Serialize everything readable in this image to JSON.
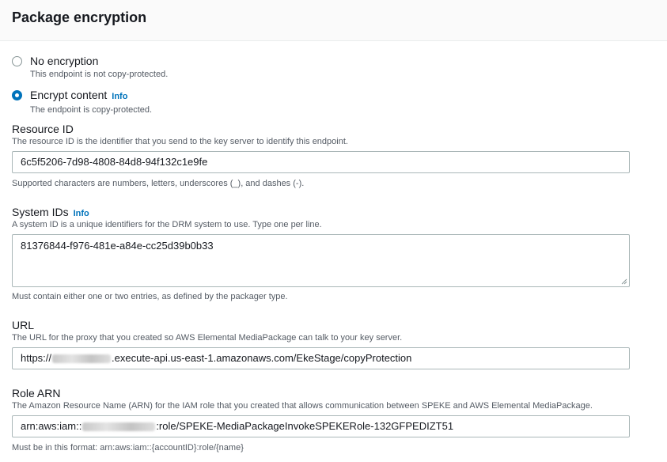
{
  "header": {
    "title": "Package encryption"
  },
  "encryption_options": [
    {
      "label": "No encryption",
      "description": "This endpoint is not copy-protected.",
      "selected": false
    },
    {
      "label": "Encrypt content",
      "info": "Info",
      "description": "The endpoint is copy-protected.",
      "selected": true
    }
  ],
  "resource_id": {
    "label": "Resource ID",
    "description": "The resource ID is the identifier that you send to the key server to identify this endpoint.",
    "value": "6c5f5206-7d98-4808-84d8-94f132c1e9fe",
    "constraint": "Supported characters are numbers, letters, underscores (_), and dashes (-)."
  },
  "system_ids": {
    "label": "System IDs",
    "info": "Info",
    "description": "A system ID is a unique identifiers for the DRM system to use. Type one per line.",
    "value": "81376844-f976-481e-a84e-cc25d39b0b33",
    "constraint": "Must contain either one or two entries, as defined by the packager type."
  },
  "url": {
    "label": "URL",
    "description": "The URL for the proxy that you created so AWS Elemental MediaPackage can talk to your key server.",
    "value_prefix": "https://",
    "value_suffix": ".execute-api.us-east-1.amazonaws.com/EkeStage/copyProtection"
  },
  "role_arn": {
    "label": "Role ARN",
    "description": "The Amazon Resource Name (ARN) for the IAM role that you created that allows communication between SPEKE and AWS Elemental MediaPackage.",
    "value_prefix": "arn:aws:iam::",
    "value_suffix": ":role/SPEKE-MediaPackageInvokeSPEKERole-132GFPEDIZT51",
    "constraint": "Must be in this format: arn:aws:iam::{accountID}:role/{name}"
  }
}
